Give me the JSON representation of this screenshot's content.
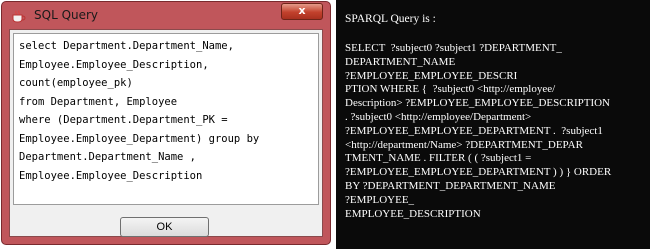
{
  "dialog": {
    "title": "SQL Query",
    "close_glyph": "x",
    "icon": "java-cup-icon",
    "query_lines": [
      "select Department.Department_Name,",
      "Employee.Employee_Description,",
      "count(employee_pk)",
      "from Department, Employee",
      "where (Department.Department_PK =",
      "Employee.Employee_Department) group by",
      "Department.Department_Name ,",
      "Employee.Employee_Description"
    ],
    "ok_label": "OK"
  },
  "sparql": {
    "heading": "SPARQL Query is :",
    "lines": [
      "SELECT  ?subject0 ?subject1 ?DEPARTMENT_",
      "DEPARTMENT_NAME",
      "?EMPLOYEE_EMPLOYEE_DESCRI",
      "PTION WHERE {  ?subject0 <http://employee/",
      "Description> ?EMPLOYEE_EMPLOYEE_DESCRIPTION",
      ". ?subject0 <http://employee/Department>",
      "?EMPLOYEE_EMPLOYEE_DEPARTMENT .  ?subject1",
      "<http://department/Name> ?DEPARTMENT_DEPAR",
      "TMENT_NAME . FILTER ( ( ?subject1 =",
      "?EMPLOYEE_EMPLOYEE_DEPARTMENT ) ) } ORDER",
      "BY ?DEPARTMENT_DEPARTMENT_NAME",
      "?EMPLOYEE_",
      "EMPLOYEE_DESCRIPTION"
    ]
  },
  "colors": {
    "dialog_frame": "#c0565b",
    "close_button": "#c2412c",
    "panel_bg": "#0a0a0a"
  }
}
